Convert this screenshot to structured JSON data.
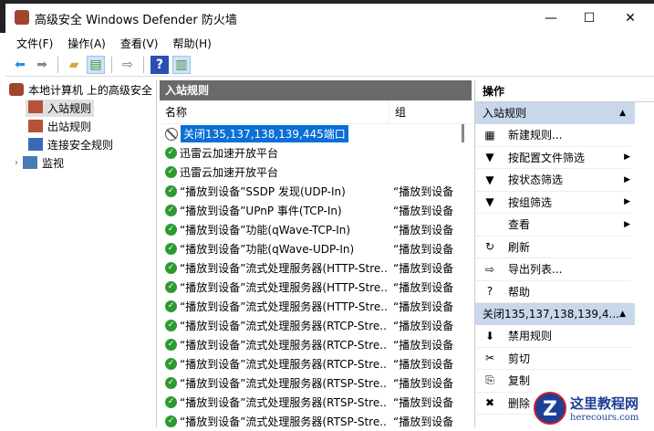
{
  "window": {
    "title": "高级安全 Windows Defender 防火墙",
    "minimize": "—",
    "maximize": "☐",
    "close": "✕"
  },
  "menu": [
    "文件(F)",
    "操作(A)",
    "查看(V)",
    "帮助(H)"
  ],
  "tree": {
    "root": "本地计算机 上的高级安全",
    "items": [
      "入站规则",
      "出站规则",
      "连接安全规则",
      "监视"
    ]
  },
  "middle": {
    "title": "入站规则",
    "col_name": "名称",
    "col_group": "组",
    "rows": [
      {
        "name": "关闭135,137,138,139,445端口",
        "group": "",
        "state": "blocked"
      },
      {
        "name": "迅雷云加速开放平台",
        "group": "",
        "state": "enabled"
      },
      {
        "name": "迅雷云加速开放平台",
        "group": "",
        "state": "enabled"
      },
      {
        "name": "“播放到设备”SSDP 发现(UDP-In)",
        "group": "“播放到设备",
        "state": "enabled"
      },
      {
        "name": "“播放到设备”UPnP 事件(TCP-In)",
        "group": "“播放到设备",
        "state": "enabled"
      },
      {
        "name": "“播放到设备”功能(qWave-TCP-In)",
        "group": "“播放到设备",
        "state": "enabled"
      },
      {
        "name": "“播放到设备”功能(qWave-UDP-In)",
        "group": "“播放到设备",
        "state": "enabled"
      },
      {
        "name": "“播放到设备”流式处理服务器(HTTP-Stre...",
        "group": "“播放到设备",
        "state": "enabled"
      },
      {
        "name": "“播放到设备”流式处理服务器(HTTP-Stre...",
        "group": "“播放到设备",
        "state": "enabled"
      },
      {
        "name": "“播放到设备”流式处理服务器(HTTP-Stre...",
        "group": "“播放到设备",
        "state": "enabled"
      },
      {
        "name": "“播放到设备”流式处理服务器(RTCP-Stre...",
        "group": "“播放到设备",
        "state": "enabled"
      },
      {
        "name": "“播放到设备”流式处理服务器(RTCP-Stre...",
        "group": "“播放到设备",
        "state": "enabled"
      },
      {
        "name": "“播放到设备”流式处理服务器(RTCP-Stre...",
        "group": "“播放到设备",
        "state": "enabled"
      },
      {
        "name": "“播放到设备”流式处理服务器(RTSP-Stre...",
        "group": "“播放到设备",
        "state": "enabled"
      },
      {
        "name": "“播放到设备”流式处理服务器(RTSP-Stre...",
        "group": "“播放到设备",
        "state": "enabled"
      },
      {
        "name": "“播放到设备”流式处理服务器(RTSP-Stre...",
        "group": "“播放到设备",
        "state": "enabled"
      }
    ]
  },
  "actions": {
    "title": "操作",
    "section1": "入站规则",
    "items1": [
      {
        "label": "新建规则...",
        "icon": "▦",
        "arrow": ""
      },
      {
        "label": "按配置文件筛选",
        "icon": "▼",
        "arrow": "▶"
      },
      {
        "label": "按状态筛选",
        "icon": "▼",
        "arrow": "▶"
      },
      {
        "label": "按组筛选",
        "icon": "▼",
        "arrow": "▶"
      },
      {
        "label": "查看",
        "icon": "",
        "arrow": "▶"
      },
      {
        "label": "刷新",
        "icon": "↻",
        "arrow": ""
      },
      {
        "label": "导出列表...",
        "icon": "⇨",
        "arrow": ""
      },
      {
        "label": "帮助",
        "icon": "?",
        "arrow": ""
      }
    ],
    "section2": "关闭135,137,138,139,4...",
    "items2": [
      {
        "label": "禁用规则",
        "icon": "⬇"
      },
      {
        "label": "剪切",
        "icon": "✂"
      },
      {
        "label": "复制",
        "icon": "⎘"
      },
      {
        "label": "删除",
        "icon": "✖"
      }
    ]
  },
  "watermark": {
    "name": "这里教程网",
    "url": "herecours.com"
  }
}
